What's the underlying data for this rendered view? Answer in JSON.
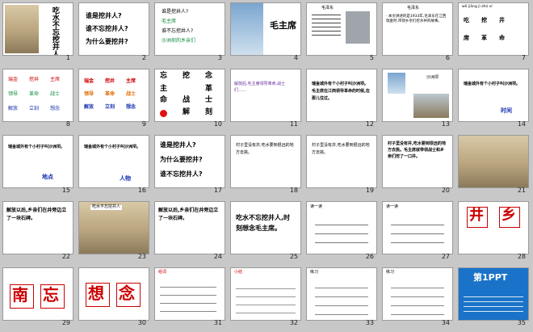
{
  "slides": [
    {
      "n": "1",
      "title": "吃水不忘挖井人"
    },
    {
      "n": "2",
      "lines": [
        "谁是挖井人?",
        "谁不忘挖井人?",
        "为什么要挖井?"
      ]
    },
    {
      "n": "3",
      "lines": [
        "谁是挖井人?",
        "毛主席",
        "谁不忘挖井人?",
        "沙洲坝的乡亲们"
      ]
    },
    {
      "n": "4",
      "title": "毛主席"
    },
    {
      "n": "5",
      "heading": "毛泽东"
    },
    {
      "n": "6",
      "heading": "毛泽东",
      "text": "· 本文讲述的是1933年,毛泽东在江西瑞金时,带领乡亲们挖水井的故事。"
    },
    {
      "n": "7",
      "pinyin": "wǒ jiāng jì zhǔ xí",
      "words": [
        "吃",
        "挖",
        "井",
        "席",
        "革",
        "命"
      ]
    },
    {
      "n": "8",
      "words": [
        "瑞金",
        "挖井",
        "主席",
        "领导",
        "革命",
        "战士",
        "解放",
        "立刻",
        "想念"
      ]
    },
    {
      "n": "9",
      "words": [
        "瑞金",
        "挖井",
        "主席",
        "领导",
        "革命",
        "战士",
        "解放",
        "立刻",
        "想念"
      ]
    },
    {
      "n": "10",
      "chars": [
        "忘",
        "挖",
        "念",
        "主",
        "革",
        "命",
        "战",
        "士",
        "解",
        "刻"
      ]
    },
    {
      "n": "11",
      "text": "解放后,毛主席领导革命,战士们……"
    },
    {
      "n": "12",
      "text": "瑞金城外有个小村子叫沙洲坝。毛主席在江西领导革命的时候,在那儿住过。"
    },
    {
      "n": "13",
      "label": "沙洲坝"
    },
    {
      "n": "14",
      "text": "瑞金城外有个小村子叫沙洲坝。",
      "word": "时间"
    },
    {
      "n": "15",
      "text": "瑞金城外有个小村子叫沙洲坝。",
      "word": "地点"
    },
    {
      "n": "16",
      "text": "瑞金城外有个小村子叫沙洲坝。",
      "word": "人物"
    },
    {
      "n": "17",
      "lines": [
        "谁是挖井人?",
        "为什么要挖井?",
        "谁不忘挖井人?"
      ]
    },
    {
      "n": "18",
      "text": "村子里没有井,吃水要到很远的地方去挑。"
    },
    {
      "n": "19",
      "text": "村子里没有井,吃水要到很远的地方去挑。"
    },
    {
      "n": "20",
      "text": "村子里没有井,吃水要到很远的地方去挑。毛主席就带领战士和乡亲们挖了一口井。"
    },
    {
      "n": "21"
    },
    {
      "n": "22",
      "text": "解放以后,乡亲们在井旁边立了一块石碑。"
    },
    {
      "n": "23",
      "label": "吃水不忘挖井人"
    },
    {
      "n": "24",
      "text": "解放以后,乡亲们在井旁边立了一块石碑。"
    },
    {
      "n": "25",
      "text": "吃水不忘挖井人,时刻想念毛主席。"
    },
    {
      "n": "26",
      "text": "读一读"
    },
    {
      "n": "27",
      "text": "读一读"
    },
    {
      "n": "28",
      "chars": [
        "井",
        "乡"
      ]
    },
    {
      "n": "29",
      "chars": [
        "南",
        "忘"
      ]
    },
    {
      "n": "30",
      "chars": [
        "想",
        "念"
      ]
    },
    {
      "n": "31",
      "text": "组词"
    },
    {
      "n": "32",
      "text": "小结"
    },
    {
      "n": "33",
      "text": "练习"
    },
    {
      "n": "34",
      "text": "练习"
    },
    {
      "n": "35",
      "title": "第1PPT"
    }
  ]
}
